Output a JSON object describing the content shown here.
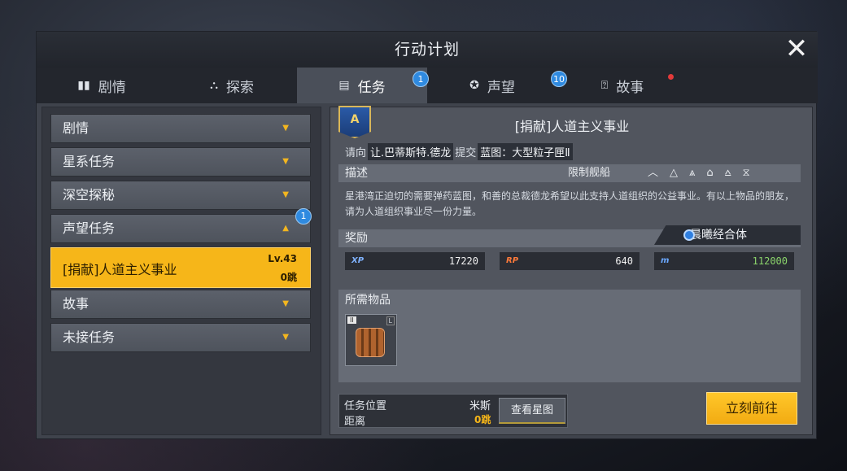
{
  "window": {
    "title": "行动计划"
  },
  "tabs": [
    {
      "label": "剧情",
      "icon": "book-icon",
      "glyph": "▮▮",
      "badge": ""
    },
    {
      "label": "探索",
      "icon": "explore-icon",
      "glyph": "⛬",
      "badge": ""
    },
    {
      "label": "任务",
      "icon": "task-clipboard-icon",
      "glyph": "▤",
      "badge": "1"
    },
    {
      "label": "声望",
      "icon": "reputation-icon",
      "glyph": "✪",
      "badge": "10"
    },
    {
      "label": "故事",
      "icon": "story-icon",
      "glyph": "⍰",
      "badge": ""
    }
  ],
  "categories": [
    {
      "label": "剧情"
    },
    {
      "label": "星系任务"
    },
    {
      "label": "深空探秘"
    },
    {
      "label": "声望任务",
      "badge": "1"
    },
    {
      "label": "故事"
    },
    {
      "label": "未接任务"
    }
  ],
  "selected_mission": {
    "name": "[捐献]人道主义事业",
    "level": "Lv.43",
    "jumps": "0跳"
  },
  "detail": {
    "emblem": "A",
    "title": "[捐献]人道主义事业",
    "request_prefix": "请向",
    "npc": "让.巴蒂斯特.德龙",
    "submit": "提交",
    "blueprint": "蓝图：大型粒子匣Ⅱ",
    "desc_head": "描述",
    "ship_limit": "限制舰船",
    "description": "星港湾正迫切的需要弹药蓝图，和善的总裁德龙希望以此支持人道组织的公益事业。有以上物品的朋友，请为人道组织事业尽一份力量。",
    "reward_head": "奖励",
    "faction": "晨曦经合体",
    "rewards": [
      {
        "label": "XP",
        "value": "17220",
        "color": "#7fb2ff"
      },
      {
        "label": "RP",
        "value": "640",
        "color": "#ff7a3a"
      },
      {
        "label": "m",
        "value": "112000",
        "color": "#8bd46b"
      }
    ],
    "items_head": "所需物品",
    "item": {
      "grade": "II",
      "mark": "L"
    },
    "location_label": "任务位置",
    "distance_label": "距离",
    "location": "米斯",
    "distance": "0跳",
    "view_map": "查看星图",
    "go": "立刻前往"
  },
  "colors": {
    "accent": "#f6b619",
    "badge": "#2f8ae0",
    "panel": "#51555e"
  }
}
